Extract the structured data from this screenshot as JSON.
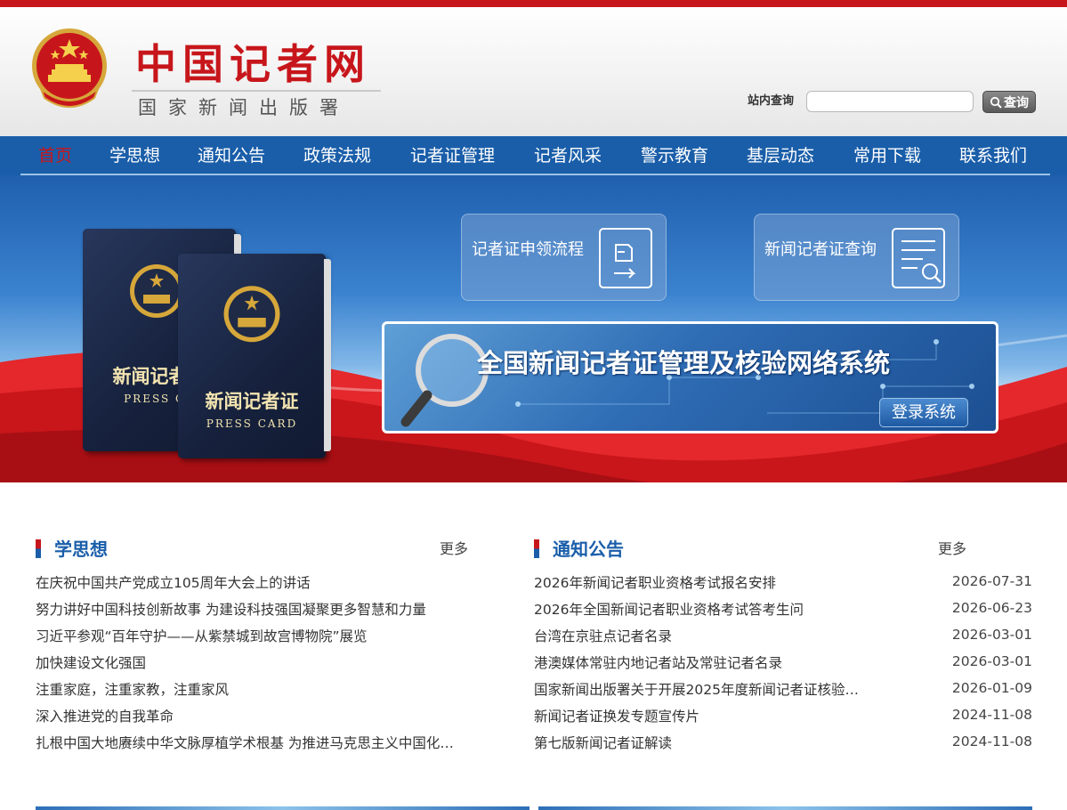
{
  "header": {
    "site_title": "中国记者网",
    "site_subtitle": "国家新闻出版署",
    "search_label": "站内查询",
    "search_value": "",
    "search_button": "查询"
  },
  "nav": {
    "items": [
      "首页",
      "学思想",
      "通知公告",
      "政策法规",
      "记者证管理",
      "记者风采",
      "警示教育",
      "基层动态",
      "常用下载",
      "联系我们"
    ],
    "active_index": 0
  },
  "banner": {
    "card_back": {
      "title": "新闻记者证",
      "subtitle": "PRESS CA"
    },
    "card_front": {
      "title": "新闻记者证",
      "subtitle": "PRESS CARD"
    },
    "quick_links": [
      {
        "label": "记者证申领流程",
        "icon": "hand-pointing-document-icon"
      },
      {
        "label": "新闻记者证查询",
        "icon": "document-search-icon"
      }
    ],
    "system_title": "全国新闻记者证管理及核验网络系统",
    "login_button": "登录系统"
  },
  "sections": {
    "study": {
      "title": "学思想",
      "more": "更多",
      "items": [
        "在庆祝中国共产党成立105周年大会上的讲话",
        "努力讲好中国科技创新故事 为建设科技强国凝聚更多智慧和力量",
        "习近平参观“百年守护——从紫禁城到故宫博物院”展览",
        "加快建设文化强国",
        "注重家庭，注重家教，注重家风",
        "深入推进党的自我革命",
        "扎根中国大地赓续中华文脉厚植学术根基 为推进马克思主义中国化…"
      ]
    },
    "notices": {
      "title": "通知公告",
      "more": "更多",
      "items": [
        {
          "title": "2026年新闻记者职业资格考试报名安排",
          "date": "2026-07-31"
        },
        {
          "title": "2026年全国新闻记者职业资格考试答考生问",
          "date": "2026-06-23"
        },
        {
          "title": "台湾在京驻点记者名录",
          "date": "2026-03-01"
        },
        {
          "title": "港澳媒体常驻内地记者站及常驻记者名录",
          "date": "2026-03-01"
        },
        {
          "title": "国家新闻出版署关于开展2025年度新闻记者证核验…",
          "date": "2026-01-09"
        },
        {
          "title": "新闻记者证换发专题宣传片",
          "date": "2024-11-08"
        },
        {
          "title": "第七版新闻记者证解读",
          "date": "2024-11-08"
        }
      ]
    }
  },
  "colors": {
    "brand_red": "#c7161b",
    "nav_blue": "#1a5ea9",
    "banner_red": "#d61d22"
  }
}
